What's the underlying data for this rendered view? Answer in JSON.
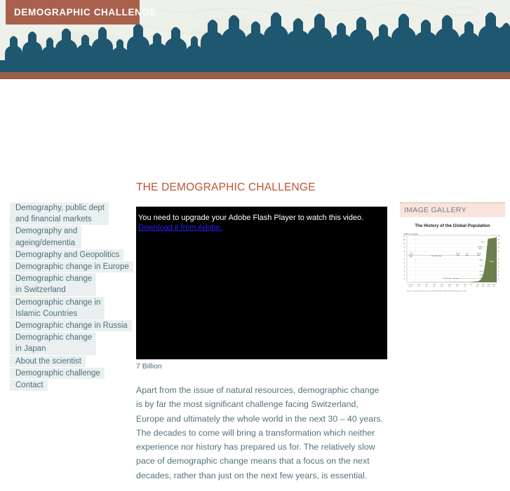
{
  "header": {
    "site_title": "DEMOGRAPHIC CHALLENGE",
    "banner_icon": "crowd-silhouette-banner",
    "accent_brown": "#a9614e",
    "accent_teal": "#1f5670"
  },
  "sidebar": {
    "items": [
      {
        "lines": [
          "Demography, public dept",
          "and financial markets"
        ]
      },
      {
        "lines": [
          "Demography and",
          "ageing/dementia"
        ]
      },
      {
        "lines": [
          "Demography and Geopolitics"
        ]
      },
      {
        "lines": [
          "Demographic change in Europe"
        ]
      },
      {
        "lines": [
          "Demographic change",
          "in Switzerland"
        ]
      },
      {
        "lines": [
          "Demographic change in",
          "Islamic Countries"
        ]
      },
      {
        "lines": [
          "Demographic change in Russia"
        ]
      },
      {
        "lines": [
          "Demographic change",
          "in Japan"
        ]
      },
      {
        "lines": [
          "About the scientist"
        ]
      },
      {
        "lines": [
          "Demographic challenge"
        ]
      },
      {
        "lines": [
          "Contact"
        ]
      }
    ]
  },
  "main": {
    "title": "THE DEMOGRAPHIC CHALLENGE",
    "title_color": "#c0542f",
    "video": {
      "flash_message": "You need to upgrade your Adobe Flash Player to watch this video.",
      "flash_link_label": "Download it from Adobe.",
      "flash_link_color": "#2222ee",
      "caption": "7 Billion"
    },
    "body_text": "Apart from the issue of natural resources, demographic change is by far the most significant challenge facing Switzerland, Europe and ultimately the whole world in the next 30 – 40 years. The decades to come will bring a transformation which neither experience nor history has prepared us for. The relatively slow pace of demographic change means that a focus on the next decades, rather than just on the next few years, is essential."
  },
  "gallery": {
    "heading": "IMAGE GALLERY",
    "heading_bg": "#f8e4dd"
  },
  "chart_data": {
    "type": "area",
    "title": "The History of the Global Population",
    "ylabel": "Billions of people",
    "xlabel": "",
    "ylim": [
      0,
      12
    ],
    "yticks": [
      1,
      2,
      3,
      4,
      5,
      6,
      7,
      8,
      9,
      10,
      11,
      12
    ],
    "xtick_labels": [
      "1+ million\nyears BC",
      "7000\nBC",
      "6000\nBC",
      "5000\nBC",
      "4000\nBC",
      "3000\nBC",
      "2000\nBC",
      "1000\nBC",
      "A.D.\n1",
      "1000\nA.D.",
      "2000\nA.D.",
      "3000\nA.D.",
      "4000\nA.D.",
      "5000\nA.D."
    ],
    "annotations": [
      "Old Stone Age",
      "New Stone Age",
      "Bronze Age",
      "Iron Age",
      "Middle Ages",
      "Modern Age",
      "Black Death—the plague",
      "Future",
      "2100",
      "2000",
      "1975",
      "1950",
      "1900",
      "1800"
    ],
    "source_note": "Source: Population Reference Bureau and United Nations, World Population Projections to 2150 (1998).",
    "series": [
      {
        "name": "World population",
        "x": [
          "1+ million BC",
          "7000 BC",
          "6000 BC",
          "5000 BC",
          "4000 BC",
          "3000 BC",
          "2000 BC",
          "1000 BC",
          "A.D. 1",
          "1000 A.D.",
          "1800",
          "1900",
          "1950",
          "1975",
          "2000",
          "2100"
        ],
        "values": [
          0.0,
          0.01,
          0.02,
          0.03,
          0.05,
          0.1,
          0.15,
          0.2,
          0.3,
          0.4,
          1.0,
          1.6,
          2.5,
          4.0,
          6.1,
          11.0
        ]
      }
    ],
    "area_color": "#6e7f4e",
    "grid": false,
    "legend_position": "none"
  }
}
